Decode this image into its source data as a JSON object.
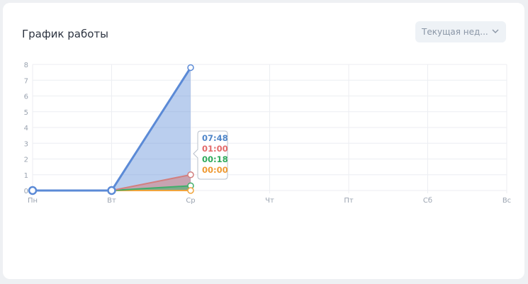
{
  "header": {
    "title": "График работы",
    "period_select": {
      "value": "Текущая нед..."
    }
  },
  "chart_data": {
    "type": "area",
    "categories": [
      "Пн",
      "Вт",
      "Ср",
      "Чт",
      "Пт",
      "Сб",
      "Вс"
    ],
    "yticks": [
      "0",
      "1",
      "2",
      "3",
      "4",
      "5",
      "6",
      "7",
      "8"
    ],
    "ylim": [
      0,
      8
    ],
    "grid": true,
    "series": [
      {
        "color": "#5b8ad6",
        "values": [
          0,
          0,
          7.8
        ]
      },
      {
        "color": "#d27f7f",
        "values": [
          0,
          0,
          1.0
        ]
      },
      {
        "color": "#3fae6a",
        "values": [
          0,
          0,
          0.3
        ]
      },
      {
        "color": "#f0a43c",
        "values": [
          0,
          0,
          0.0
        ]
      }
    ],
    "tooltip": {
      "category": "Ср",
      "entries": [
        {
          "text": "07:48",
          "color": "#4f86c9"
        },
        {
          "text": "01:00",
          "color": "#e36a6a"
        },
        {
          "text": "00:18",
          "color": "#2faa5b"
        },
        {
          "text": "00:00",
          "color": "#ef9a33"
        }
      ]
    }
  }
}
